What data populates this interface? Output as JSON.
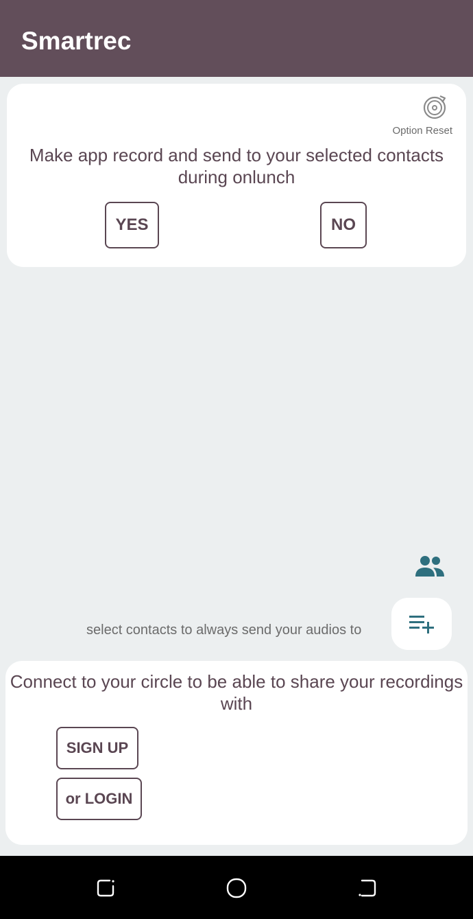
{
  "app": {
    "title": "Smartrec"
  },
  "onlaunch_card": {
    "reset_label": "Option Reset",
    "reset_icon": "reset-icon",
    "question": "Make app record and send to your selected contacts during onlunch",
    "yes_label": "YES",
    "no_label": "NO"
  },
  "contacts": {
    "group_icon": "group-icon",
    "hint": "select contacts to always send your audios to",
    "playlist_add_icon": "playlist-add-icon"
  },
  "circle_card": {
    "text": "Connect to your circle to be able to share your recordings with",
    "signup_label": "SIGN UP",
    "login_label": "or LOGIN"
  },
  "colors": {
    "appbar": "#624e5a",
    "accent_text": "#5a4652",
    "icon_teal": "#2e6f7e",
    "background": "#eceff0"
  },
  "navbar": {
    "items": [
      "recent-apps-icon",
      "home-icon",
      "back-icon"
    ]
  }
}
